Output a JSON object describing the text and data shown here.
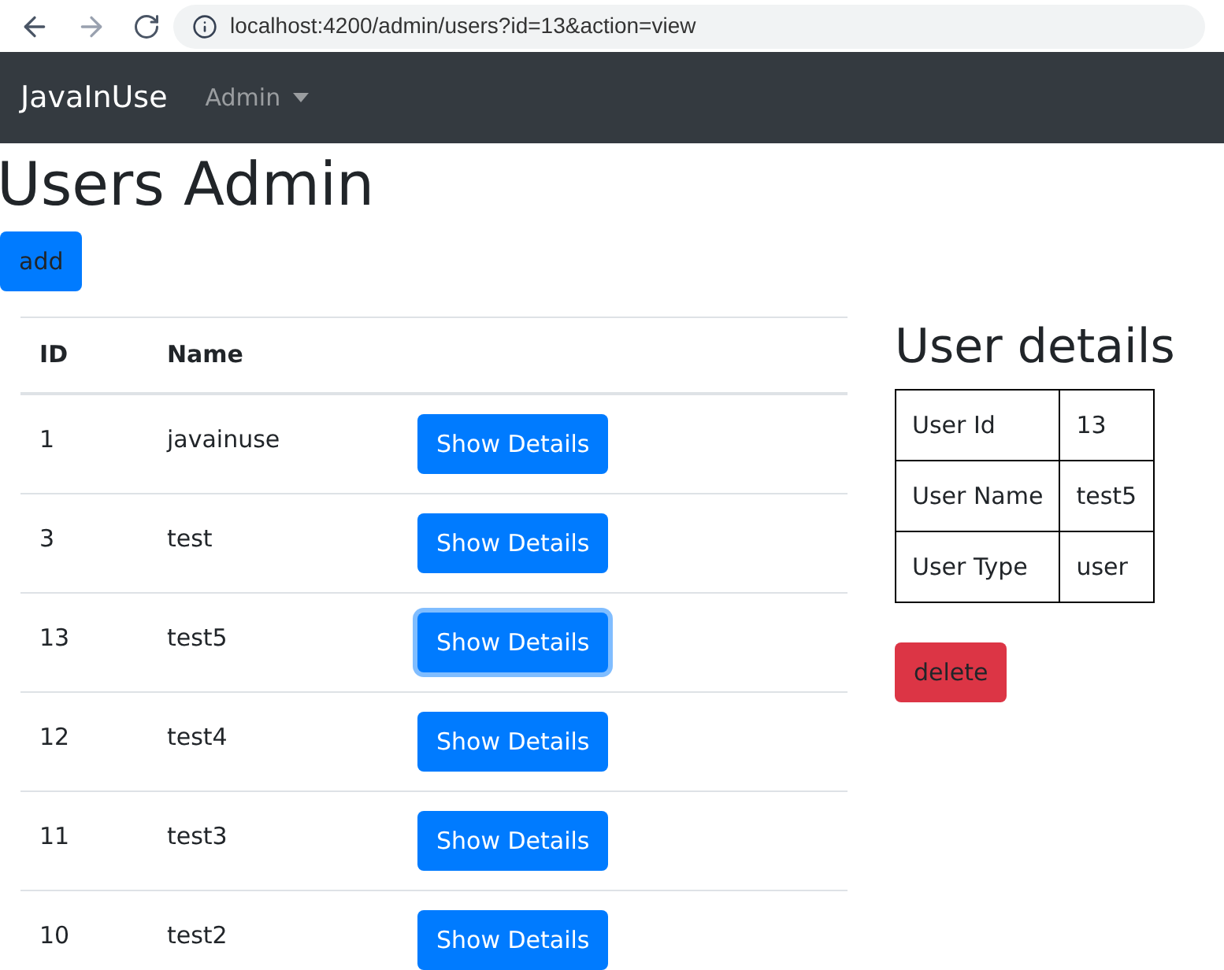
{
  "browser": {
    "url": "localhost:4200/admin/users?id=13&action=view"
  },
  "navbar": {
    "brand": "JavaInUse",
    "menu": "Admin"
  },
  "page": {
    "title": "Users Admin",
    "add_button": "add"
  },
  "table": {
    "columns": [
      "ID",
      "Name"
    ],
    "rows": [
      {
        "id": "1",
        "name": "javainuse",
        "button": "Show Details",
        "focused": false
      },
      {
        "id": "3",
        "name": "test",
        "button": "Show Details",
        "focused": false
      },
      {
        "id": "13",
        "name": "test5",
        "button": "Show Details",
        "focused": true
      },
      {
        "id": "12",
        "name": "test4",
        "button": "Show Details",
        "focused": false
      },
      {
        "id": "11",
        "name": "test3",
        "button": "Show Details",
        "focused": false
      },
      {
        "id": "10",
        "name": "test2",
        "button": "Show Details",
        "focused": false
      }
    ]
  },
  "details": {
    "title": "User details",
    "rows": [
      {
        "label": "User Id",
        "value": "13"
      },
      {
        "label": "User Name",
        "value": "test5"
      },
      {
        "label": "User Type",
        "value": "user"
      }
    ],
    "delete_button": "delete"
  }
}
